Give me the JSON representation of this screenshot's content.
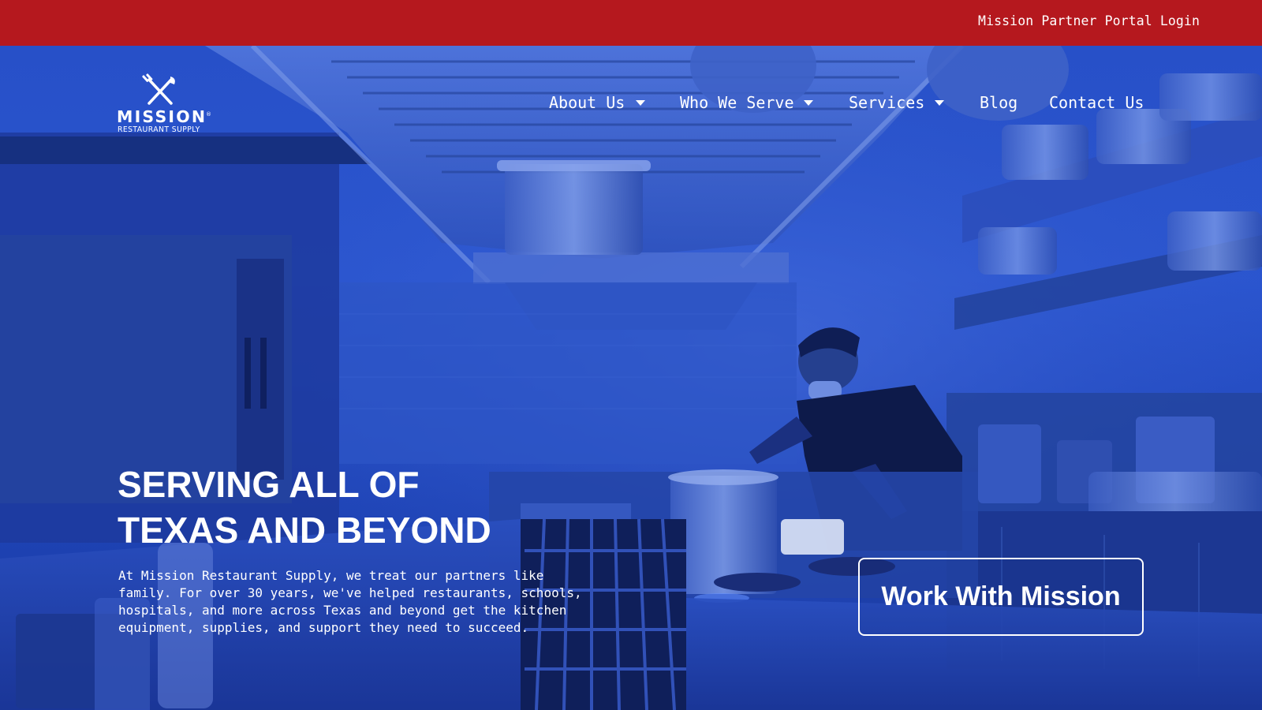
{
  "topbar": {
    "portal_login": "Mission Partner Portal Login"
  },
  "brand": {
    "name": "MISSION",
    "registered": "®",
    "tagline": "RESTAURANT SUPPLY",
    "icon": "crossed-fork-knife-icon"
  },
  "nav": {
    "items": [
      {
        "label": "About Us",
        "has_dropdown": true
      },
      {
        "label": "Who We Serve",
        "has_dropdown": true
      },
      {
        "label": "Services",
        "has_dropdown": true
      },
      {
        "label": "Blog",
        "has_dropdown": false
      },
      {
        "label": "Contact Us",
        "has_dropdown": false
      }
    ]
  },
  "hero": {
    "headline_line1": "SERVING ALL OF",
    "headline_line2": "TEXAS AND BEYOND",
    "intro_lines": [
      "At Mission Restaurant Supply, we treat our partners like",
      "family. For over 30 years, we've helped restaurants, schools,",
      "hospitals, and more across Texas and beyond get the kitchen",
      "equipment, supplies, and support they need to succeed."
    ],
    "cta_label": "Work With Mission"
  },
  "colors": {
    "topbar": "#b5181e",
    "hero_tint": "#2750c8",
    "text": "#ffffff"
  }
}
